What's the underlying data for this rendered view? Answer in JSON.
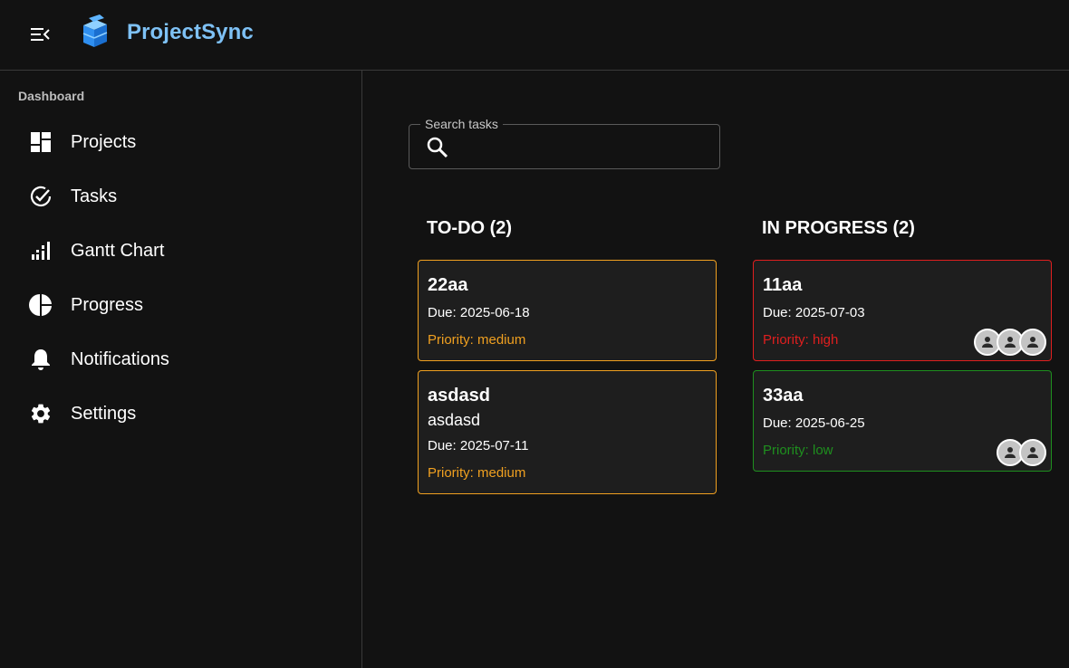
{
  "app": {
    "brand": "ProjectSync"
  },
  "sidebar": {
    "heading": "Dashboard",
    "items": [
      {
        "label": "Projects",
        "icon": "dashboard-icon"
      },
      {
        "label": "Tasks",
        "icon": "check-circle-icon"
      },
      {
        "label": "Gantt Chart",
        "icon": "gantt-icon"
      },
      {
        "label": "Progress",
        "icon": "pie-chart-icon"
      },
      {
        "label": "Notifications",
        "icon": "bell-icon"
      },
      {
        "label": "Settings",
        "icon": "gear-icon"
      }
    ]
  },
  "search": {
    "label": "Search tasks",
    "value": ""
  },
  "columns": [
    {
      "title": "TO-DO (2)",
      "cards": [
        {
          "title": "22aa",
          "description": "",
          "due": "Due: 2025-06-18",
          "priority": "Priority: medium",
          "color": "#f0a020",
          "avatars": 0
        },
        {
          "title": "asdasd",
          "description": "asdasd",
          "due": "Due: 2025-07-11",
          "priority": "Priority: medium",
          "color": "#f0a020",
          "avatars": 0
        }
      ]
    },
    {
      "title": "IN PROGRESS (2)",
      "cards": [
        {
          "title": "11aa",
          "description": "",
          "due": "Due: 2025-07-03",
          "priority": "Priority: high",
          "color": "#e01f1f",
          "avatars": 3
        },
        {
          "title": "33aa",
          "description": "",
          "due": "Due: 2025-06-25",
          "priority": "Priority: low",
          "color": "#1e8f1e",
          "avatars": 2
        }
      ]
    }
  ]
}
